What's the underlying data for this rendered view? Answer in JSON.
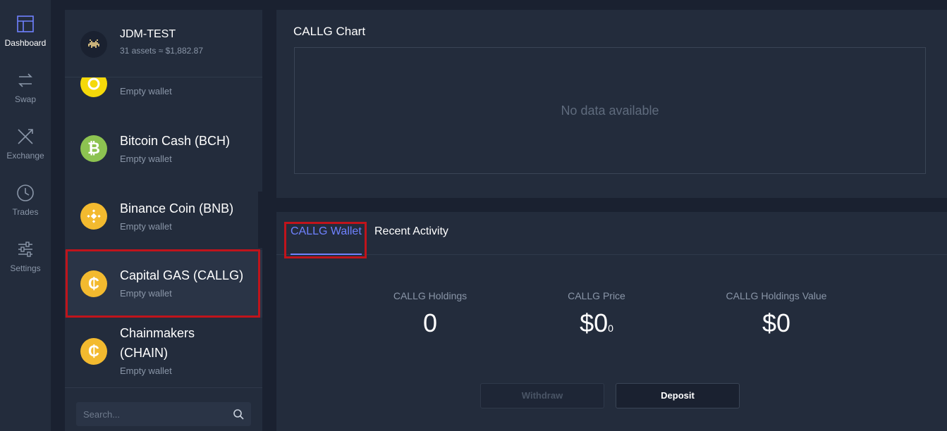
{
  "nav": {
    "items": [
      {
        "label": "Dashboard",
        "active": true
      },
      {
        "label": "Swap"
      },
      {
        "label": "Exchange"
      },
      {
        "label": "Trades"
      },
      {
        "label": "Settings"
      }
    ]
  },
  "account": {
    "name": "JDM-TEST",
    "summary": "31 assets ≈ $1,882.87"
  },
  "wallets": [
    {
      "name": "",
      "status": "Empty wallet",
      "icon": "coin-icon",
      "color": "#f5d90a"
    },
    {
      "name": "Bitcoin Cash (BCH)",
      "status": "Empty wallet",
      "icon": "bitcoin-cash-icon",
      "color": "#8dc351"
    },
    {
      "name": "Binance Coin (BNB)",
      "status": "Empty wallet",
      "icon": "binance-icon",
      "color": "#f3ba2f"
    },
    {
      "name": "Capital GAS (CALLG)",
      "status": "Empty wallet",
      "icon": "callg-icon",
      "color": "#f3ba2f",
      "selected": true
    },
    {
      "name": "Chainmakers (CHAIN)",
      "status": "Empty wallet",
      "icon": "chain-icon",
      "color": "#f3ba2f"
    }
  ],
  "search": {
    "placeholder": "Search..."
  },
  "chart": {
    "title": "CALLG Chart",
    "empty_message": "No data available"
  },
  "wallet_panel": {
    "tabs": [
      {
        "label": "CALLG Wallet",
        "active": true
      },
      {
        "label": "Recent Activity"
      }
    ],
    "stats": [
      {
        "label": "CALLG Holdings",
        "value": "0"
      },
      {
        "label": "CALLG Price",
        "value": "$0",
        "suffix": "0"
      },
      {
        "label": "CALLG Holdings Value",
        "value": "$0"
      }
    ],
    "buttons": {
      "withdraw": "Withdraw",
      "deposit": "Deposit"
    }
  },
  "colors": {
    "accent": "#6f82ff",
    "highlight": "#c0141b",
    "coin_yellow": "#f3ba2f",
    "coin_green": "#8dc351"
  }
}
